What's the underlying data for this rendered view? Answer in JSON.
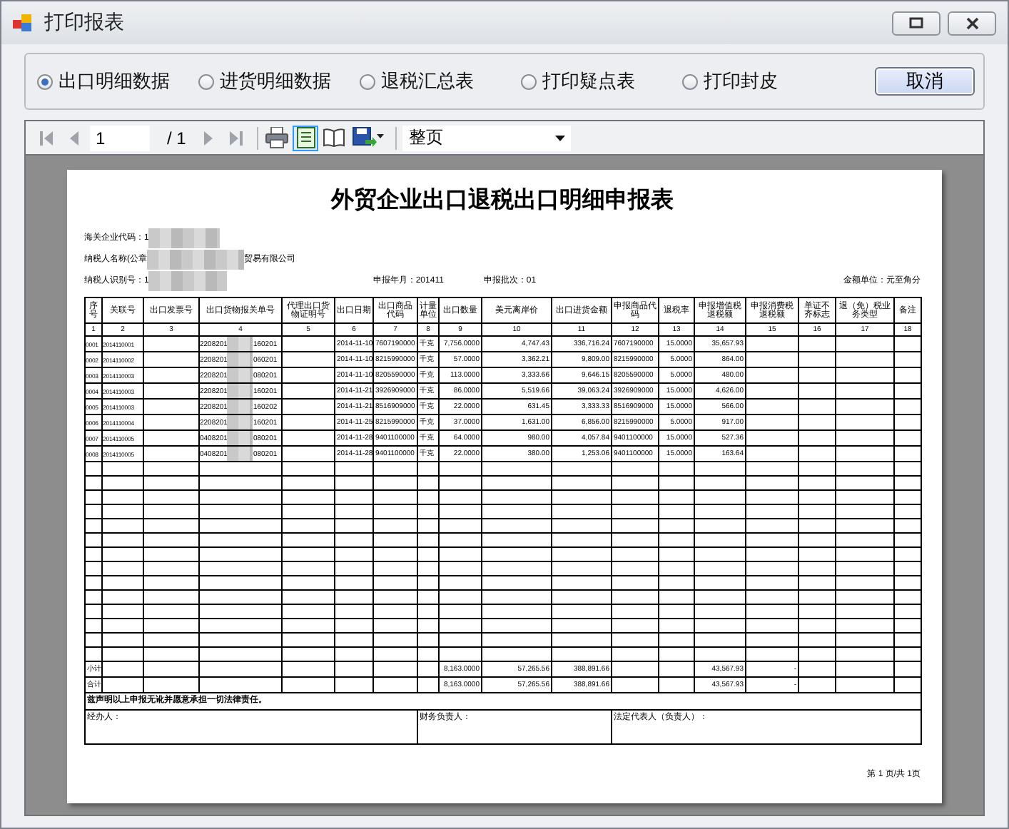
{
  "window": {
    "title": "打印报表"
  },
  "options": [
    {
      "label": "出口明细数据",
      "selected": true
    },
    {
      "label": "进货明细数据",
      "selected": false
    },
    {
      "label": "退税汇总表",
      "selected": false
    },
    {
      "label": "打印疑点表",
      "selected": false
    },
    {
      "label": "打印封皮",
      "selected": false
    }
  ],
  "cancel_button": "取消",
  "toolbar": {
    "page": "1",
    "page_total": "/ 1",
    "zoom": "整页",
    "layout_view_active": true
  },
  "report": {
    "title": "外贸企业出口退税出口明细申报表",
    "customs_code": "海关企业代码：1",
    "taxpayer_name": "纳税人名称(公章",
    "taxpayer_name_end": "贸易有限公司",
    "taxpayer_id": "纳税人识别号：1",
    "period": "申报年月：201411",
    "batch": "申报批次：01",
    "unit": "金额单位：元至角分",
    "columns": [
      {
        "title": "序号",
        "number": "1"
      },
      {
        "title": "关联号",
        "number": "2"
      },
      {
        "title": "出口发票号",
        "number": "3"
      },
      {
        "title": "出口货物报关单号",
        "number": "4"
      },
      {
        "title": "代理出口货物证明号",
        "number": "5"
      },
      {
        "title": "出口日期",
        "number": "6"
      },
      {
        "title": "出口商品代码",
        "number": "7"
      },
      {
        "title": "计量单位",
        "number": "8"
      },
      {
        "title": "出口数量",
        "number": "9"
      },
      {
        "title": "美元离岸价",
        "number": "10"
      },
      {
        "title": "出口进货金额",
        "number": "11"
      },
      {
        "title": "申报商品代码",
        "number": "12"
      },
      {
        "title": "退税率",
        "number": "13"
      },
      {
        "title": "申报增值税退税额",
        "number": "14"
      },
      {
        "title": "申报消费税退税额",
        "number": "15"
      },
      {
        "title": "单证不齐标志",
        "number": "16"
      },
      {
        "title": "退（免）税业务类型",
        "number": "17"
      },
      {
        "title": "备注",
        "number": "18"
      }
    ],
    "rows": [
      {
        "no": "0001",
        "link": "2014110001",
        "customs_start": "2208201",
        "customs_end": "160201",
        "date": "2014-11-10",
        "code": "7607190000",
        "unit": "千克",
        "qty": "7,756.0000",
        "usd": "4,747.43",
        "purchase": "336,716.24",
        "decl_code": "7607190000",
        "rate": "15.0000",
        "refund": "35,657.93"
      },
      {
        "no": "0002",
        "link": "2014110002",
        "customs_start": "2208201",
        "customs_end": "060201",
        "date": "2014-11-10",
        "code": "8215990000",
        "unit": "千克",
        "qty": "57.0000",
        "usd": "3,362.21",
        "purchase": "9,809.00",
        "decl_code": "8215990000",
        "rate": "5.0000",
        "refund": "864.00"
      },
      {
        "no": "0003",
        "link": "2014110003",
        "customs_start": "2208201",
        "customs_end": "080201",
        "date": "2014-11-10",
        "code": "8205590000",
        "unit": "千克",
        "qty": "113.0000",
        "usd": "3,333.66",
        "purchase": "9,646.15",
        "decl_code": "8205590000",
        "rate": "5.0000",
        "refund": "480.00"
      },
      {
        "no": "0004",
        "link": "2014110003",
        "customs_start": "2208201",
        "customs_end": "160201",
        "date": "2014-11-21",
        "code": "3926909000",
        "unit": "千克",
        "qty": "86.0000",
        "usd": "5,519.66",
        "purchase": "39,063.24",
        "decl_code": "3926909000",
        "rate": "15.0000",
        "refund": "4,626.00"
      },
      {
        "no": "0005",
        "link": "2014110003",
        "customs_start": "2208201",
        "customs_end": "160202",
        "date": "2014-11-21",
        "code": "8516909000",
        "unit": "千克",
        "qty": "22.0000",
        "usd": "631.45",
        "purchase": "3,333.33",
        "decl_code": "8516909000",
        "rate": "15.0000",
        "refund": "566.00"
      },
      {
        "no": "0006",
        "link": "2014110004",
        "customs_start": "2208201",
        "customs_end": "160201",
        "date": "2014-11-25",
        "code": "8215990000",
        "unit": "千克",
        "qty": "37.0000",
        "usd": "1,631.00",
        "purchase": "6,856.00",
        "decl_code": "8215990000",
        "rate": "5.0000",
        "refund": "917.00"
      },
      {
        "no": "0007",
        "link": "2014110005",
        "customs_start": "0408201",
        "customs_end": "080201",
        "date": "2014-11-28",
        "code": "9401100000",
        "unit": "千克",
        "qty": "64.0000",
        "usd": "980.00",
        "purchase": "4,057.84",
        "decl_code": "9401100000",
        "rate": "15.0000",
        "refund": "527.36"
      },
      {
        "no": "0008",
        "link": "2014110005",
        "customs_start": "0408201",
        "customs_end": "080201",
        "date": "2014-11-28",
        "code": "9401100000",
        "unit": "千克",
        "qty": "22.0000",
        "usd": "380.00",
        "purchase": "1,253.06",
        "decl_code": "9401100000",
        "rate": "15.0000",
        "refund": "163.64"
      }
    ],
    "summary_rows": [
      {
        "label": "小计",
        "qty": "8,163.0000",
        "usd": "57,265.56",
        "purchase": "388,891.66",
        "refund": "43,567.93",
        "consumption": "-"
      },
      {
        "label": "合计",
        "qty": "8,163.0000",
        "usd": "57,265.56",
        "purchase": "388,891.66",
        "refund": "43,567.93",
        "consumption": "-"
      }
    ],
    "declaration": "兹声明以上申报无讹并愿意承担一切法律责任。",
    "signatures": [
      "经办人：",
      "财务负责人：",
      "法定代表人（负责人）："
    ],
    "page_footer": "第 1 页/共 1页"
  }
}
